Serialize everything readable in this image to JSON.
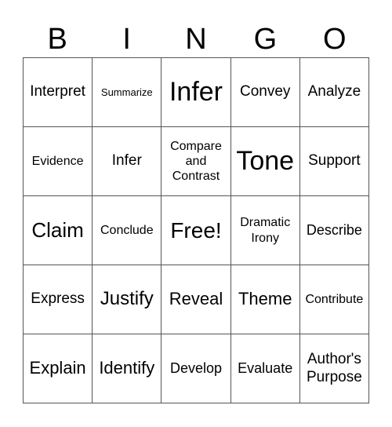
{
  "header": [
    "B",
    "I",
    "N",
    "G",
    "O"
  ],
  "cells": [
    "Interpret",
    "Summarize",
    "Infer",
    "Convey",
    "Analyze",
    "Evidence",
    "Infer",
    "Compare and Contrast",
    "Tone",
    "Support",
    "Claim",
    "Conclude",
    "Free!",
    "Dramatic Irony",
    "Describe",
    "Express",
    "Justify",
    "Reveal",
    "Theme",
    "Contribute",
    "Explain",
    "Identify",
    "Develop",
    "Evaluate",
    "Author's Purpose"
  ]
}
